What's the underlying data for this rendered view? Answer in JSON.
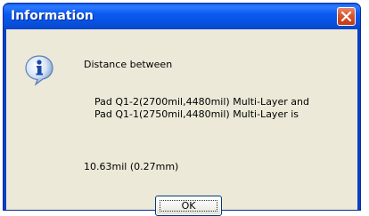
{
  "window": {
    "title": "Information",
    "close_icon": "close-icon"
  },
  "dialog": {
    "icon": "info-icon",
    "line1": "Distance between",
    "line2": "Pad Q1-2(2700mil,4480mil)  Multi-Layer and",
    "line3": "Pad Q1-1(2750mil,4480mil)  Multi-Layer is",
    "line4": "10.63mil  (0.27mm)",
    "ok_label": "OK"
  },
  "colors": {
    "titlebar": "#0a5af2",
    "client": "#ece9d8",
    "close_button": "#d8552f"
  }
}
